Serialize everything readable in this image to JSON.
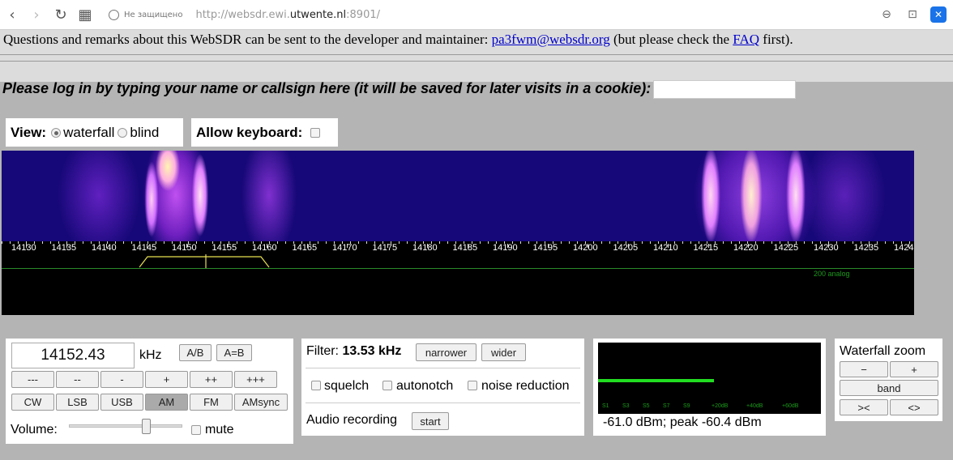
{
  "browser": {
    "security_label": "Не защищено",
    "url_prefix": "http://websdr.ewi.",
    "url_host": "utwente.nl",
    "url_suffix": ":8901/"
  },
  "info": {
    "text_before": "Questions and remarks about this WebSDR can be sent to the developer and maintainer: ",
    "email": "pa3fwm@websdr.org",
    "text_middle": " (but please check the ",
    "faq": "FAQ",
    "text_after": " first)."
  },
  "login": {
    "prompt": "Please log in by typing your name or callsign here (it will be saved for later visits in a cookie):",
    "value": ""
  },
  "view": {
    "label": "View:",
    "option_waterfall": "waterfall",
    "option_blind": "blind",
    "selected": "waterfall"
  },
  "keyboard": {
    "label": "Allow keyboard:",
    "checked": false
  },
  "frequency_scale": {
    "labels": [
      "14130",
      "14135",
      "14140",
      "14145",
      "14150",
      "14155",
      "14160",
      "14165",
      "14170",
      "14175",
      "14180",
      "14185",
      "14190",
      "14195",
      "14200",
      "14205",
      "14210",
      "14215",
      "14220",
      "14225",
      "14230",
      "14235",
      "1424"
    ],
    "corner_text": "200 analog"
  },
  "tuning": {
    "frequency": "14152.43",
    "unit": "kHz",
    "ab_label": "A/B",
    "a_eq_b_label": "A=B",
    "step_buttons": [
      "---",
      "--",
      "-",
      "+",
      "++",
      "+++"
    ],
    "modes": [
      "CW",
      "LSB",
      "USB",
      "AM",
      "FM",
      "AMsync"
    ],
    "active_mode": "AM",
    "volume_label": "Volume:",
    "volume_level": 0.68,
    "mute_label": "mute"
  },
  "filter": {
    "label": "Filter:",
    "bandwidth": "13.53 kHz",
    "narrower_label": "narrower",
    "wider_label": "wider",
    "squelch_label": "squelch",
    "autonotch_label": "autonotch",
    "noise_reduction_label": "noise reduction",
    "recording_label": "Audio recording",
    "start_label": "start"
  },
  "smeter": {
    "reading": "-61.0 dBm; peak  -60.4 dBm",
    "scale": [
      "S1",
      "S3",
      "S5",
      "S7",
      "S9",
      "+20dB",
      "+40dB",
      "+60dB"
    ],
    "level_fraction": 0.52
  },
  "zoom": {
    "title": "Waterfall zoom",
    "minus_label": "−",
    "plus_label": "+",
    "band_label": "band",
    "left_label": "><",
    "right_label": "<>"
  }
}
